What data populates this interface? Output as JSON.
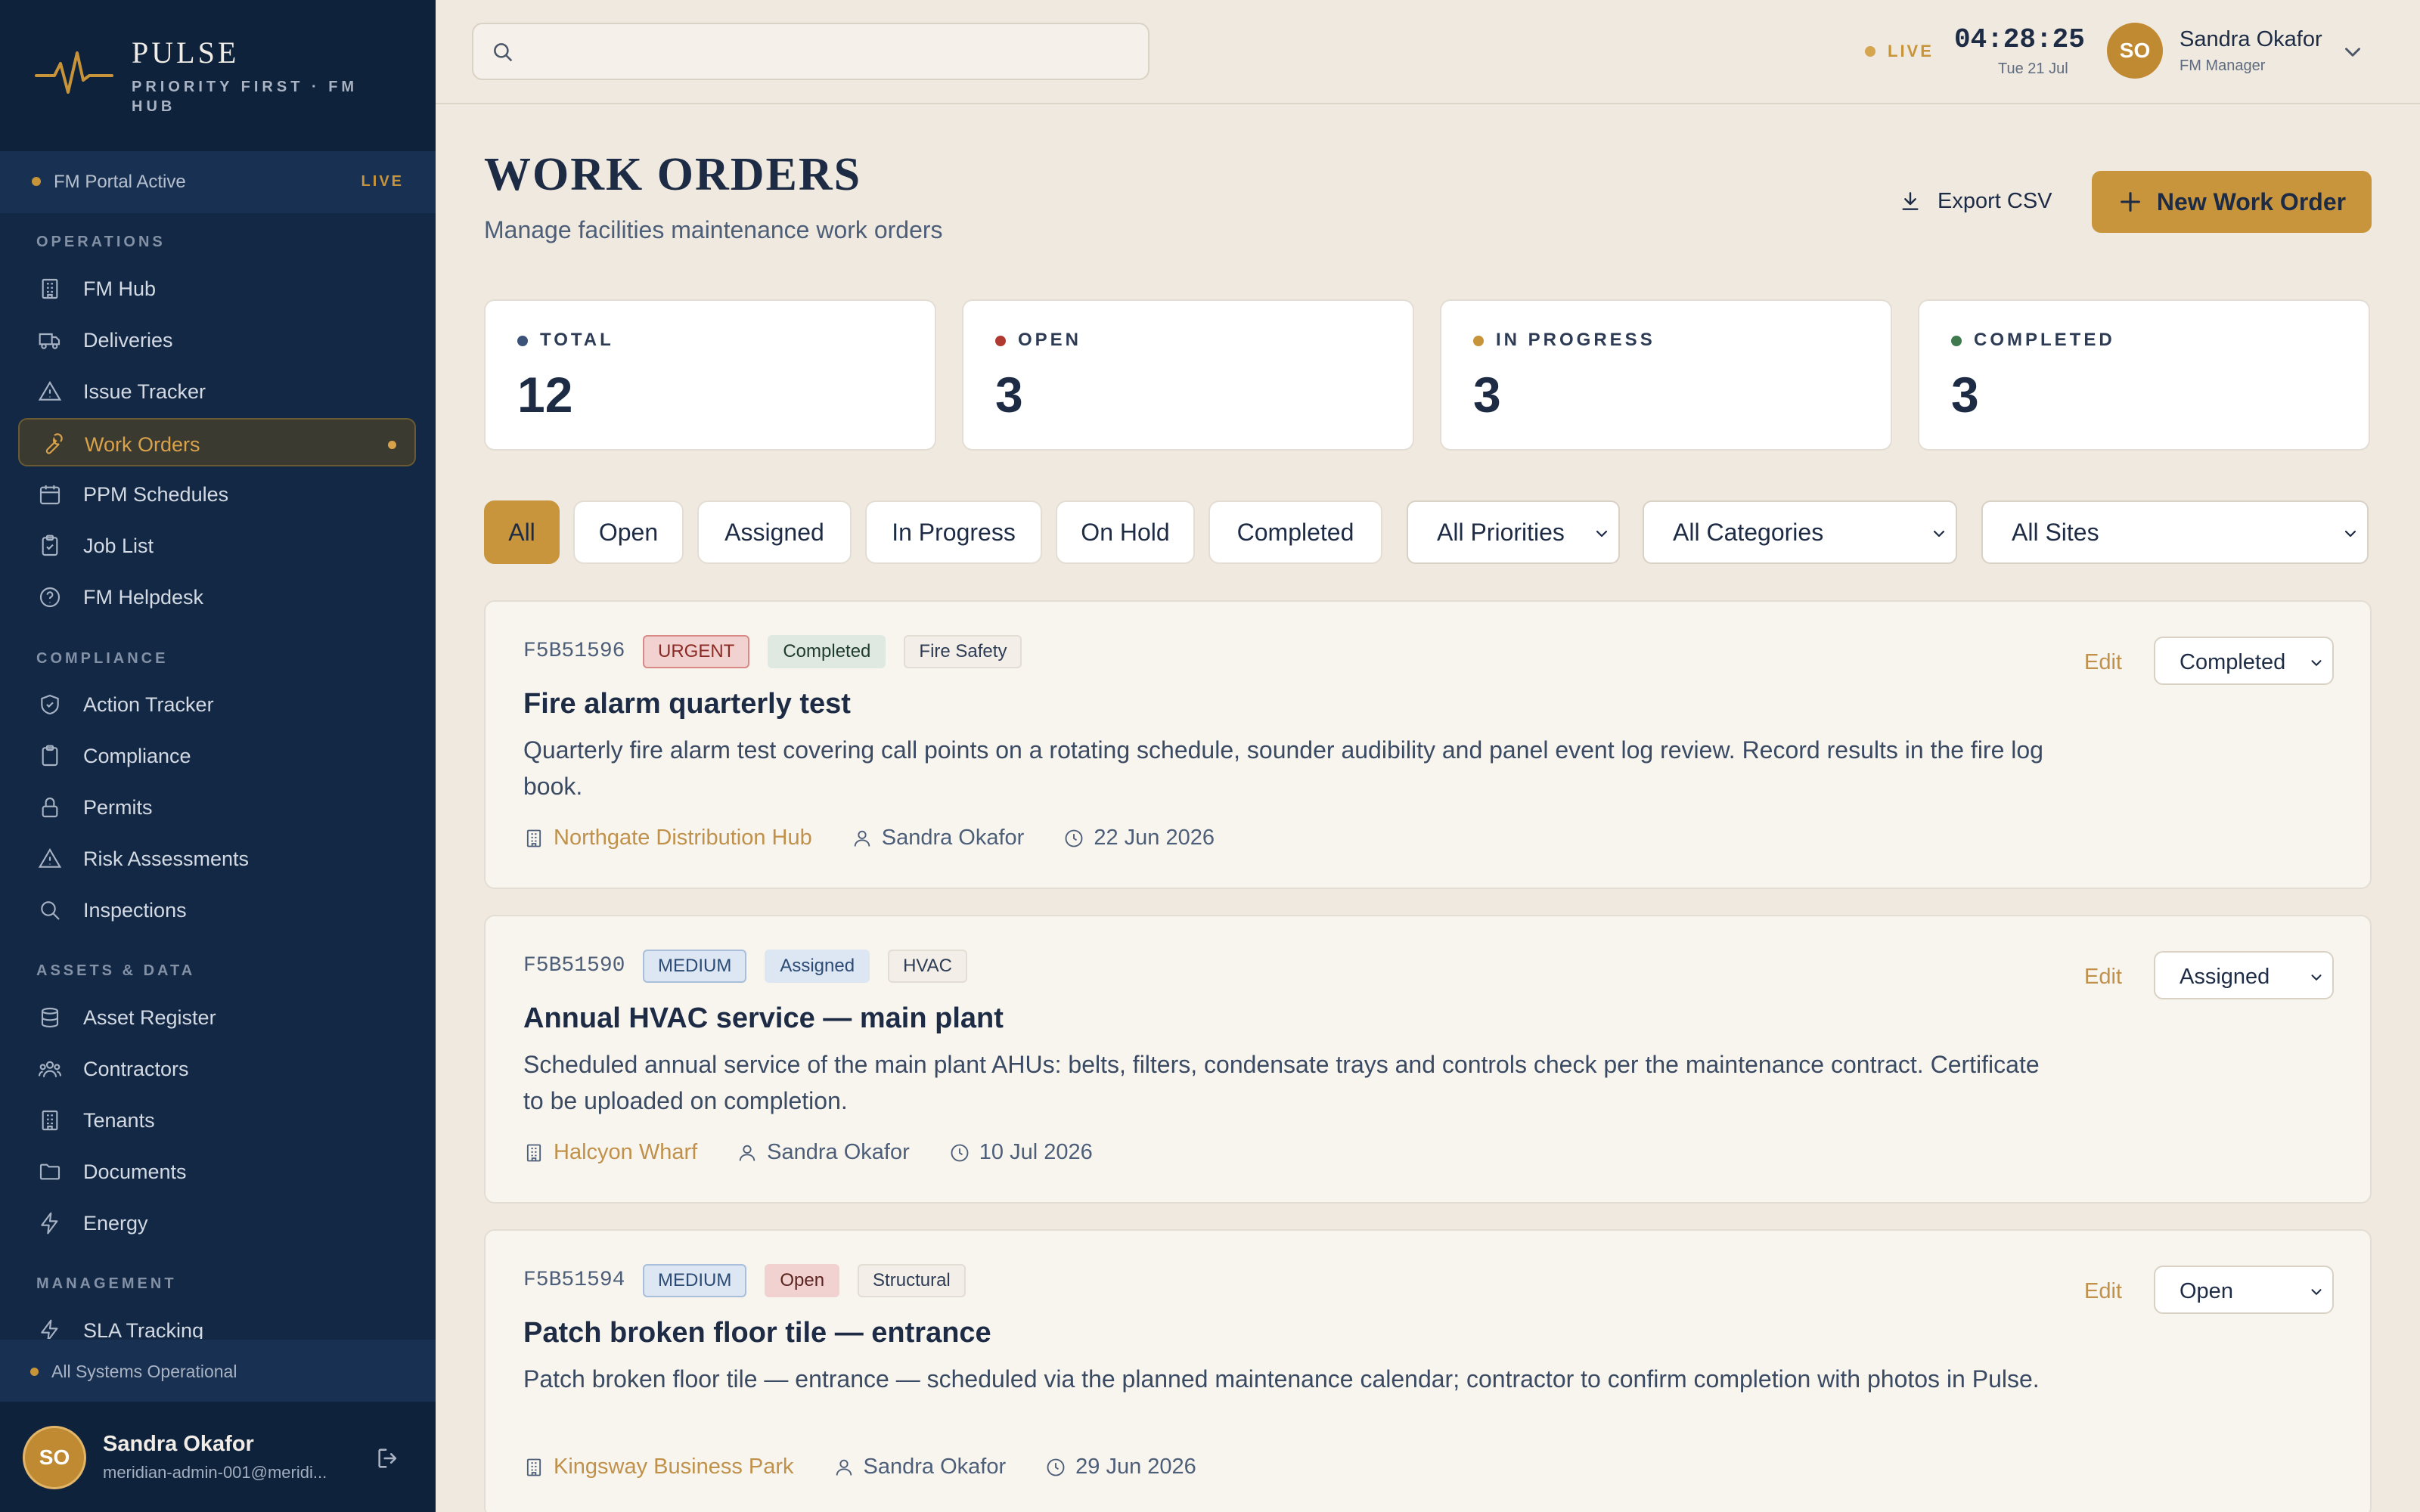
{
  "brand": {
    "name": "PULSE",
    "subtitle": "PRIORITY FIRST · FM HUB"
  },
  "portal": {
    "status": "FM Portal Active",
    "live": "LIVE"
  },
  "nav": {
    "operations_title": "OPERATIONS",
    "operations": [
      {
        "label": "FM Hub",
        "icon": "building-icon"
      },
      {
        "label": "Deliveries",
        "icon": "truck-icon"
      },
      {
        "label": "Issue Tracker",
        "icon": "warning-icon"
      },
      {
        "label": "Work Orders",
        "icon": "wrench-icon",
        "active": true
      },
      {
        "label": "PPM Schedules",
        "icon": "calendar-icon"
      },
      {
        "label": "Job List",
        "icon": "clipboard-check-icon"
      },
      {
        "label": "FM Helpdesk",
        "icon": "help-circle-icon"
      }
    ],
    "compliance_title": "COMPLIANCE",
    "compliance": [
      {
        "label": "Action Tracker",
        "icon": "shield-check-icon"
      },
      {
        "label": "Compliance",
        "icon": "clipboard-icon"
      },
      {
        "label": "Permits",
        "icon": "lock-icon"
      },
      {
        "label": "Risk Assessments",
        "icon": "warning-icon"
      },
      {
        "label": "Inspections",
        "icon": "search-icon"
      }
    ],
    "assets_title": "ASSETS & DATA",
    "assets": [
      {
        "label": "Asset Register",
        "icon": "database-icon"
      },
      {
        "label": "Contractors",
        "icon": "users-icon"
      },
      {
        "label": "Tenants",
        "icon": "building-icon"
      },
      {
        "label": "Documents",
        "icon": "folder-icon"
      },
      {
        "label": "Energy",
        "icon": "bolt-icon"
      }
    ],
    "management_title": "MANAGEMENT",
    "management": [
      {
        "label": "SLA Tracking",
        "icon": "bolt-icon"
      }
    ]
  },
  "system_status": "All Systems Operational",
  "sidebar_user": {
    "initials": "SO",
    "name": "Sandra Okafor",
    "email": "meridian-admin-001@meridi..."
  },
  "topbar": {
    "search_placeholder": "",
    "live": "LIVE",
    "clock": "04:28:25",
    "date": "Tue 21 Jul",
    "user_initials": "SO",
    "user_name": "Sandra Okafor",
    "user_role": "FM Manager"
  },
  "header": {
    "title": "WORK ORDERS",
    "subtitle": "Manage facilities maintenance work orders",
    "export_label": "Export CSV",
    "new_label": "New Work Order"
  },
  "stats": [
    {
      "label": "TOTAL",
      "value": "12",
      "color": "#3b5378"
    },
    {
      "label": "OPEN",
      "value": "3",
      "color": "#b03a32"
    },
    {
      "label": "IN PROGRESS",
      "value": "3",
      "color": "#c8943a"
    },
    {
      "label": "COMPLETED",
      "value": "3",
      "color": "#3f7a4f"
    }
  ],
  "filters": {
    "chips": [
      "All",
      "Open",
      "Assigned",
      "In Progress",
      "On Hold",
      "Completed"
    ],
    "active_chip": "All",
    "priority": "All Priorities",
    "category": "All Categories",
    "site": "All Sites"
  },
  "work_orders": [
    {
      "id": "F5B51596",
      "priority": "URGENT",
      "status": "Completed",
      "category": "Fire Safety",
      "title": "Fire alarm quarterly test",
      "description": "Quarterly fire alarm test covering call points on a rotating schedule, sounder audibility and panel event log review. Record results in the fire log book.",
      "site": "Northgate Distribution Hub",
      "assignee": "Sandra Okafor",
      "due": "22 Jun 2026",
      "edit": "Edit",
      "status_select": "Completed"
    },
    {
      "id": "F5B51590",
      "priority": "MEDIUM",
      "status": "Assigned",
      "category": "HVAC",
      "title": "Annual HVAC service — main plant",
      "description": "Scheduled annual service of the main plant AHUs: belts, filters, condensate trays and controls check per the maintenance contract. Certificate to be uploaded on completion.",
      "site": "Halcyon Wharf",
      "assignee": "Sandra Okafor",
      "due": "10 Jul 2026",
      "edit": "Edit",
      "status_select": "Assigned"
    },
    {
      "id": "F5B51594",
      "priority": "MEDIUM",
      "status": "Open",
      "category": "Structural",
      "title": "Patch broken floor tile — entrance",
      "description": "Patch broken floor tile — entrance — scheduled via the planned maintenance calendar; contractor to confirm completion with photos in Pulse.",
      "site": "Kingsway Business Park",
      "assignee": "Sandra Okafor",
      "due": "29 Jun 2026",
      "edit": "Edit",
      "status_select": "Open"
    }
  ]
}
